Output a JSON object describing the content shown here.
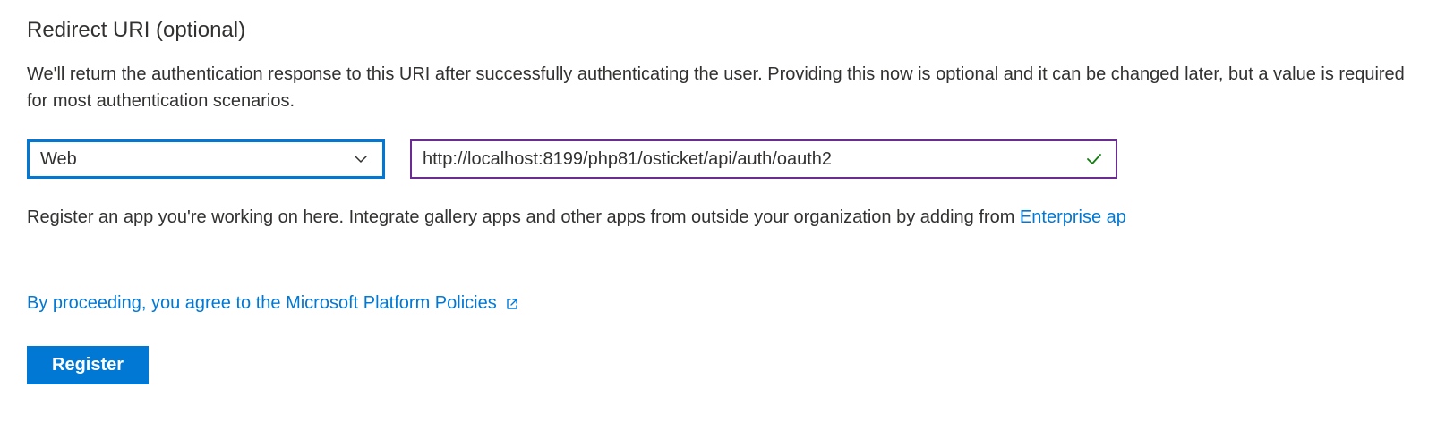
{
  "section": {
    "title": "Redirect URI (optional)",
    "description": "We'll return the authentication response to this URI after successfully authenticating the user. Providing this now is optional and it can be changed later, but a value is required for most authentication scenarios."
  },
  "form": {
    "platform_selected": "Web",
    "redirect_uri_value": "http://localhost:8199/php81/osticket/api/auth/oauth2"
  },
  "helper": {
    "prefix": "Register an app you're working on here. Integrate gallery apps and other apps from outside your organization by adding from ",
    "link_text": "Enterprise ap"
  },
  "policies": {
    "link_text": "By proceeding, you agree to the Microsoft Platform Policies"
  },
  "actions": {
    "register_label": "Register"
  }
}
